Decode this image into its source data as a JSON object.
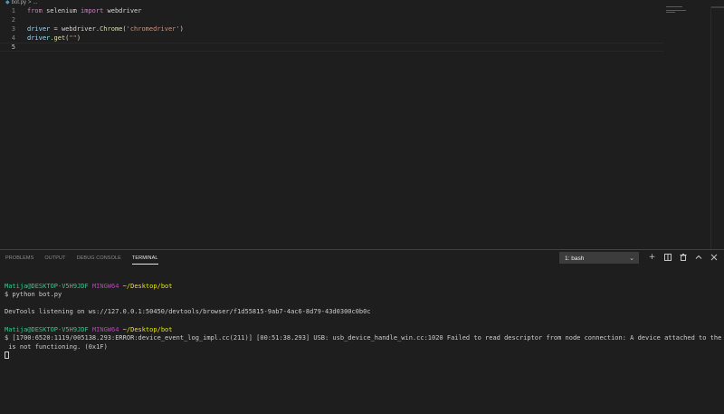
{
  "breadcrumb": {
    "file": "bot.py",
    "separator": ">",
    "trail": "..."
  },
  "editor": {
    "lines": [
      {
        "number": "1",
        "code": [
          {
            "t": "from",
            "c": "kw-import"
          },
          {
            "t": " selenium ",
            "c": "plain"
          },
          {
            "t": "import",
            "c": "kw-import"
          },
          {
            "t": " webdriver",
            "c": "plain"
          }
        ]
      },
      {
        "number": "2",
        "code": []
      },
      {
        "number": "3",
        "code": [
          {
            "t": "driver",
            "c": "var"
          },
          {
            "t": " = webdriver.",
            "c": "plain"
          },
          {
            "t": "Chrome",
            "c": "fn"
          },
          {
            "t": "(",
            "c": "plain"
          },
          {
            "t": "'chromedriver'",
            "c": "str"
          },
          {
            "t": ")",
            "c": "plain"
          }
        ]
      },
      {
        "number": "4",
        "code": [
          {
            "t": "driver",
            "c": "var"
          },
          {
            "t": ".",
            "c": "plain"
          },
          {
            "t": "get",
            "c": "fn"
          },
          {
            "t": "(",
            "c": "plain"
          },
          {
            "t": "\"\"",
            "c": "str"
          },
          {
            "t": ")",
            "c": "plain"
          }
        ]
      },
      {
        "number": "5",
        "code": [],
        "current": true
      }
    ]
  },
  "panel": {
    "tabs": [
      {
        "label": "PROBLEMS",
        "active": false
      },
      {
        "label": "OUTPUT",
        "active": false
      },
      {
        "label": "DEBUG CONSOLE",
        "active": false
      },
      {
        "label": "TERMINAL",
        "active": true
      }
    ],
    "terminal_select": "1: bash",
    "actions": [
      {
        "name": "new-terminal-icon",
        "glyph": "+"
      },
      {
        "name": "split-terminal-icon",
        "glyph": "split"
      },
      {
        "name": "trash-icon",
        "glyph": "trash"
      },
      {
        "name": "maximize-panel-icon",
        "glyph": "^"
      },
      {
        "name": "close-panel-icon",
        "glyph": "x"
      }
    ]
  },
  "terminal": {
    "prompt1": {
      "user": "Matija@DESKTOP-V5H9JDF",
      "shell": "MINGW64",
      "path": "~/Desktop/bot"
    },
    "command": "$ python bot.py",
    "devtools": "DevTools listening on ws://127.0.0.1:50450/devtools/browser/f1d55815-9ab7-4ac6-8d79-43d0300c0b0c",
    "prompt2": {
      "user": "Matija@DESKTOP-V5H9JDF",
      "shell": "MINGW64",
      "path": "~/Desktop/bot"
    },
    "error_line1": "$ [1700:6520:1119/005138.293:ERROR:device_event_log_impl.cc(211)] [00:51:38.293] USB: usb_device_handle_win.cc:1020 Failed to read descriptor from node connection: A device attached to the system",
    "error_line2": " is not functioning. (0x1F)"
  }
}
